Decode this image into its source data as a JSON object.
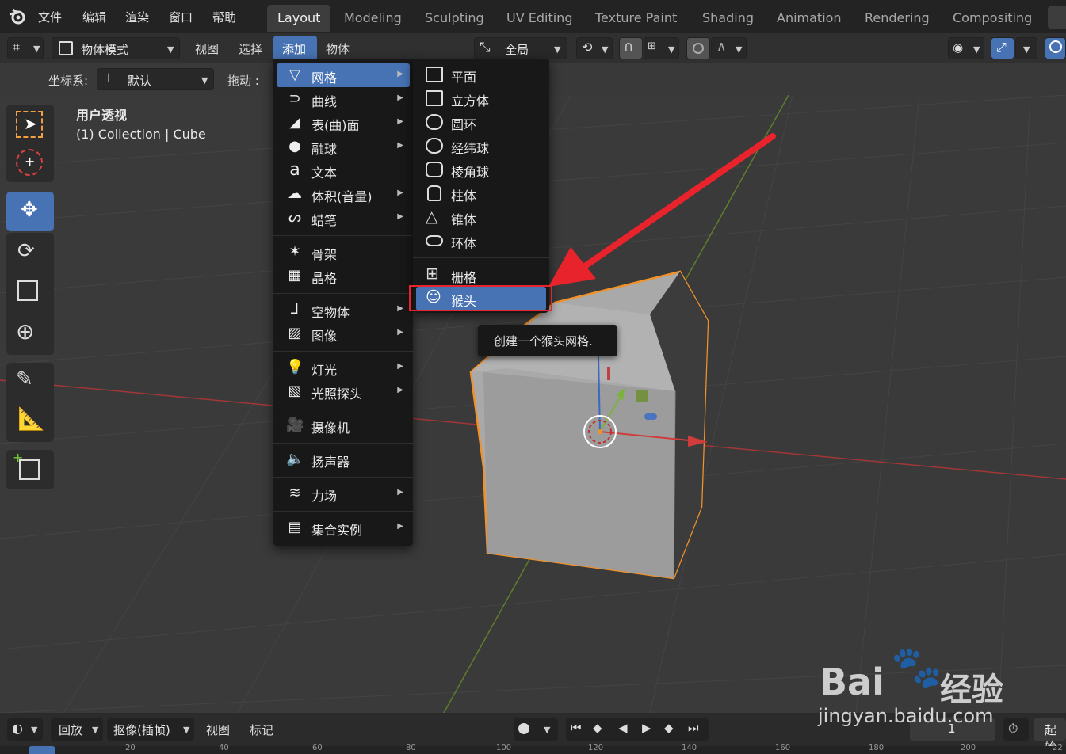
{
  "topbar": {
    "menus": [
      "文件",
      "编辑",
      "渲染",
      "窗口",
      "帮助"
    ],
    "workspaces": [
      "Layout",
      "Modeling",
      "Sculpting",
      "UV Editing",
      "Texture Paint",
      "Shading",
      "Animation",
      "Rendering",
      "Compositing"
    ],
    "active_workspace": "Layout"
  },
  "header": {
    "mode": "物体模式",
    "view": "视图",
    "select": "选择",
    "add": "添加",
    "object": "物体",
    "transform_orientation": "全局"
  },
  "header2": {
    "coord_label": "坐标系:",
    "coord_value": "默认",
    "drag_label": "拖动 :"
  },
  "viewport": {
    "view_name": "用户透视",
    "collection": "(1) Collection | Cube"
  },
  "add_menu": {
    "items": [
      {
        "label": "网格",
        "icon": "mesh-icon",
        "arrow": true
      },
      {
        "label": "曲线",
        "icon": "curve-icon",
        "arrow": true
      },
      {
        "label": "表(曲)面",
        "icon": "surface-icon",
        "arrow": true
      },
      {
        "label": "融球",
        "icon": "metaball-icon",
        "arrow": true
      },
      {
        "label": "文本",
        "icon": "text-icon",
        "arrow": false
      },
      {
        "label": "体积(音量)",
        "icon": "volume-icon",
        "arrow": true
      },
      {
        "label": "蜡笔",
        "icon": "grease-pencil-icon",
        "arrow": true
      },
      {
        "label": "骨架",
        "icon": "armature-icon",
        "arrow": false
      },
      {
        "label": "晶格",
        "icon": "lattice-icon",
        "arrow": false
      },
      {
        "label": "空物体",
        "icon": "empty-icon",
        "arrow": true
      },
      {
        "label": "图像",
        "icon": "image-icon",
        "arrow": true
      },
      {
        "label": "灯光",
        "icon": "light-icon",
        "arrow": true
      },
      {
        "label": "光照探头",
        "icon": "light-probe-icon",
        "arrow": true
      },
      {
        "label": "摄像机",
        "icon": "camera-icon",
        "arrow": false
      },
      {
        "label": "扬声器",
        "icon": "speaker-icon",
        "arrow": false
      },
      {
        "label": "力场",
        "icon": "force-field-icon",
        "arrow": true
      },
      {
        "label": "集合实例",
        "icon": "collection-instance-icon",
        "arrow": true
      }
    ]
  },
  "mesh_submenu": {
    "items": [
      "平面",
      "立方体",
      "圆环",
      "经纬球",
      "棱角球",
      "柱体",
      "锥体",
      "环体",
      "栅格",
      "猴头"
    ],
    "highlighted": "猴头"
  },
  "tooltip": {
    "text": "创建一个猴头网格."
  },
  "timeline": {
    "playback": "回放",
    "keying": "抠像(插帧)",
    "view": "视图",
    "marker": "标记",
    "current_frame": "1",
    "start_label": "起始",
    "ruler": [
      "20",
      "40",
      "60",
      "80",
      "100",
      "120",
      "140",
      "160",
      "180",
      "200",
      "22"
    ]
  },
  "watermark": {
    "brand": "Bai",
    "brand2": "经验",
    "url": "jingyan.baidu.com"
  },
  "colors": {
    "accent": "#4772b3",
    "selection_outline": "#f0922a",
    "annotation_red": "#e8232b",
    "x_axis": "#b23a3a",
    "y_axis": "#6a8a2a"
  }
}
